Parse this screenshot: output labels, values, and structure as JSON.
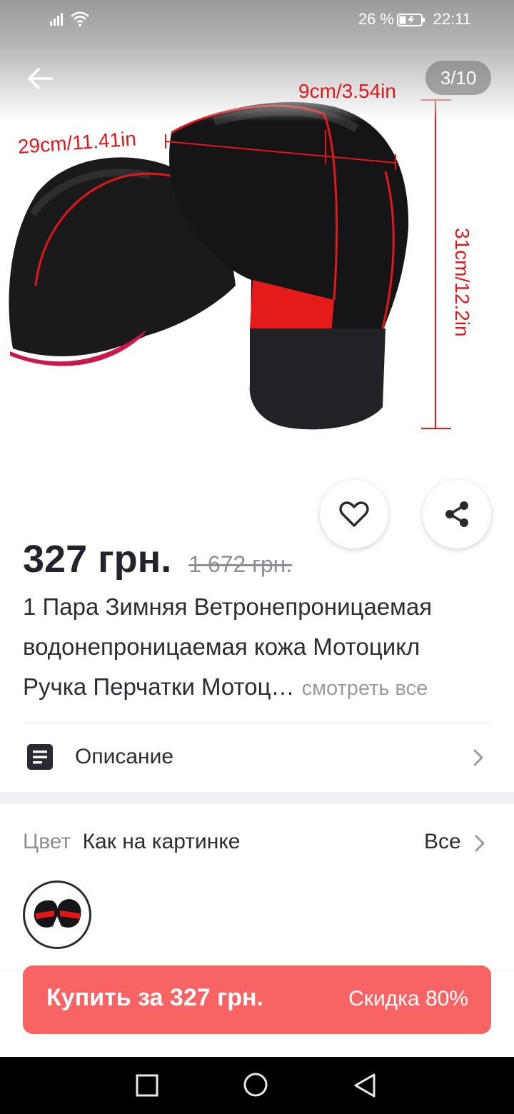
{
  "status_bar": {
    "battery_percent": "26 %",
    "time": "22:11"
  },
  "gallery": {
    "counter": "3/10",
    "dimensions": {
      "width_label": "29cm/11.41in",
      "depth_label": "9cm/3.54in",
      "height_label": "31cm/12.2in"
    }
  },
  "product": {
    "price": "327 грн.",
    "old_price": "1 672 грн.",
    "title_lines": [
      "1 Пара Зимняя Ветронепроницаемая",
      "водонепроницаемая кожа Мотоцикл",
      "Ручка Перчатки Мотоц…"
    ],
    "see_all": "смотреть все"
  },
  "description": {
    "label": "Описание"
  },
  "color": {
    "label": "Цвет",
    "value": "Как на картинке",
    "all_label": "Все"
  },
  "buy": {
    "label": "Купить за 327 грн.",
    "discount": "Скидка 80%"
  },
  "colors": {
    "accent": "#f86363",
    "text": "#2c2c36",
    "muted": "#8e8e96"
  },
  "icons": [
    "signal-icon",
    "wifi-icon",
    "battery-icon",
    "back-arrow-icon",
    "heart-icon",
    "share-icon",
    "document-icon",
    "chevron-right-icon",
    "nav-back-icon",
    "nav-home-icon",
    "nav-recent-icon"
  ]
}
